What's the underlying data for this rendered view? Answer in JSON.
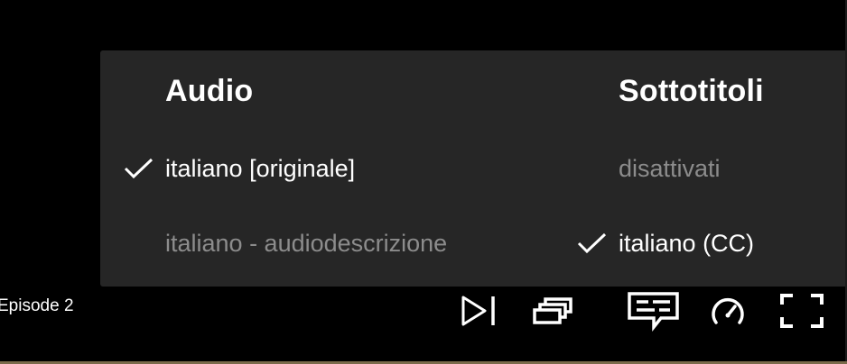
{
  "audio": {
    "heading": "Audio",
    "options": [
      {
        "label": "italiano [originale]",
        "selected": true
      },
      {
        "label": "italiano - audiodescrizione",
        "selected": false
      }
    ]
  },
  "subtitles": {
    "heading": "Sottotitoli",
    "options": [
      {
        "label": "disattivati",
        "selected": false
      },
      {
        "label": "italiano (CC)",
        "selected": true
      }
    ]
  },
  "player": {
    "episode_label": "Episode 2"
  },
  "controls": {
    "icons": [
      "next-episode-icon",
      "episodes-icon",
      "audio-subtitles-icon",
      "playback-speed-icon",
      "fullscreen-icon"
    ]
  },
  "colors": {
    "background": "#000000",
    "panel": "#262626",
    "text_selected": "#ffffff",
    "text_unselected": "#8c8c8c"
  }
}
